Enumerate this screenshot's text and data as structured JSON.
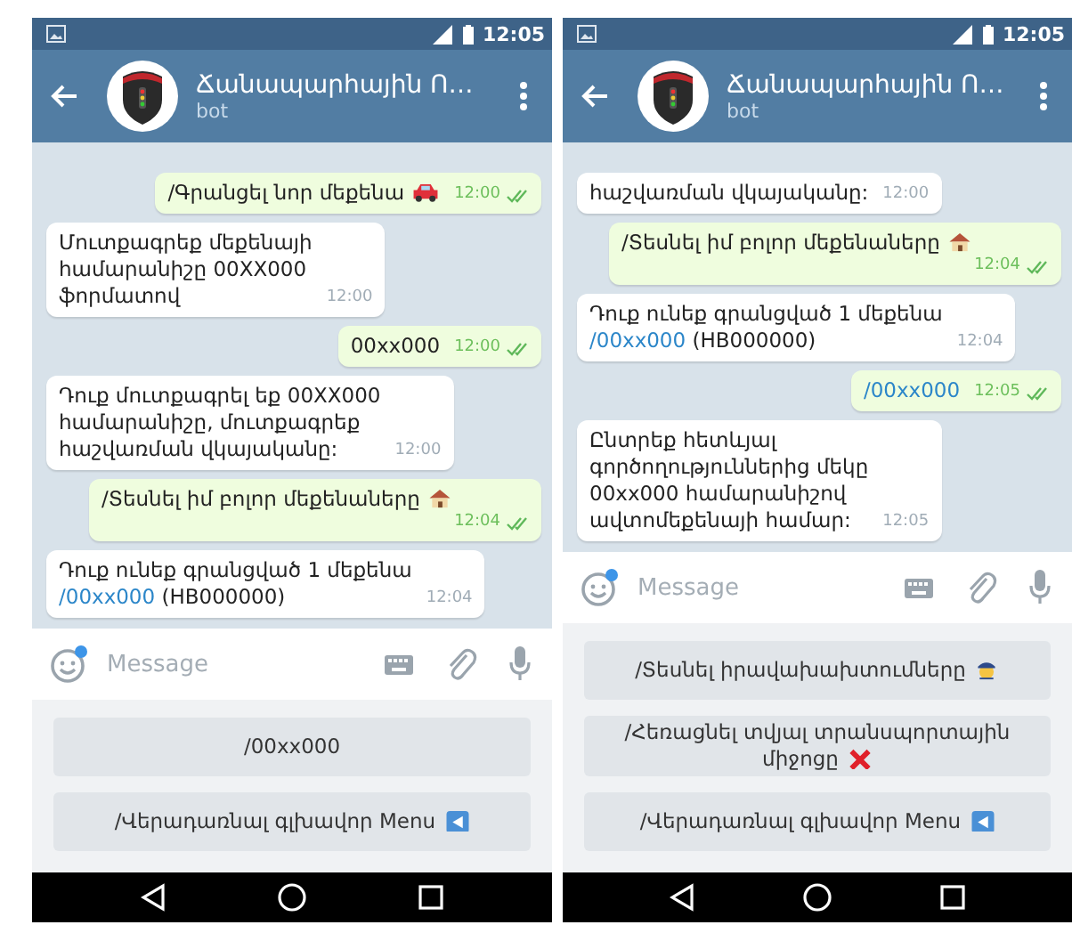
{
  "phones": [
    {
      "status_bar": {
        "time": "12:05"
      },
      "header": {
        "title": "Ճանապարհային Ո…",
        "subtitle": "bot"
      },
      "messages": [
        {
          "outgoing": true,
          "text": "/Գրանցել նոր մեքենա",
          "kind": "car",
          "time": "12:00",
          "read": true
        },
        {
          "outgoing": false,
          "text": "Մուտքագրեք մեքենայի\nհամարանիշը 00XX000\nֆորմատով",
          "time": "12:00"
        },
        {
          "outgoing": true,
          "text": "00xx000",
          "time": "12:00",
          "read": true
        },
        {
          "outgoing": false,
          "text": "Դուք մուտքագրել եք 00XX000\nհամարանիշը, մուտքագրեք\nհաշվառման վկայականը:",
          "time": "12:00"
        },
        {
          "outgoing": true,
          "text": "/Տեսնել իմ բոլոր մեքենաները",
          "kind": "house",
          "time": "12:04",
          "read": true
        },
        {
          "outgoing": false,
          "text": "Դուք ունեք գրանցված 1 մեքենա",
          "link": "/00xx000",
          "after": "(HB000000)",
          "time": "12:04"
        }
      ],
      "composer": {
        "placeholder": "Message"
      },
      "keyboard": [
        {
          "label": "/00xx000"
        },
        {
          "label": "/Վերադառնալ գլխավոր Menu",
          "kind": "back"
        }
      ]
    },
    {
      "status_bar": {
        "time": "12:05"
      },
      "header": {
        "title": "Ճանապարհային Ո…",
        "subtitle": "bot"
      },
      "messages": [
        {
          "outgoing": false,
          "text": "հաշվառման վկայականը:",
          "time": "12:00"
        },
        {
          "outgoing": true,
          "text": "/Տեսնել իմ բոլոր մեքենաները",
          "kind": "house",
          "time": "12:04",
          "read": true
        },
        {
          "outgoing": false,
          "text": "Դուք ունեք գրանցված 1 մեքենա",
          "link": "/00xx000",
          "after": "(HB000000)",
          "time": "12:04"
        },
        {
          "outgoing": true,
          "link": "/00xx000",
          "time": "12:05",
          "read": true
        },
        {
          "outgoing": false,
          "text": "Ընտրեք հետևյալ\nգործողություններից մեկը\n00xx000 համարանիշով\nավտոմեքենայի համար:",
          "time": "12:05"
        }
      ],
      "composer": {
        "placeholder": "Message"
      },
      "keyboard": [
        {
          "label": "/Տեսնել իրավախախտումները",
          "kind": "police"
        },
        {
          "label": "/Հեռացնել տվյալ տրանսպորտային\nմիջոցը",
          "kind": "cross"
        },
        {
          "label": "/Վերադառնալ գլխավոր Menu",
          "kind": "back"
        }
      ]
    }
  ]
}
